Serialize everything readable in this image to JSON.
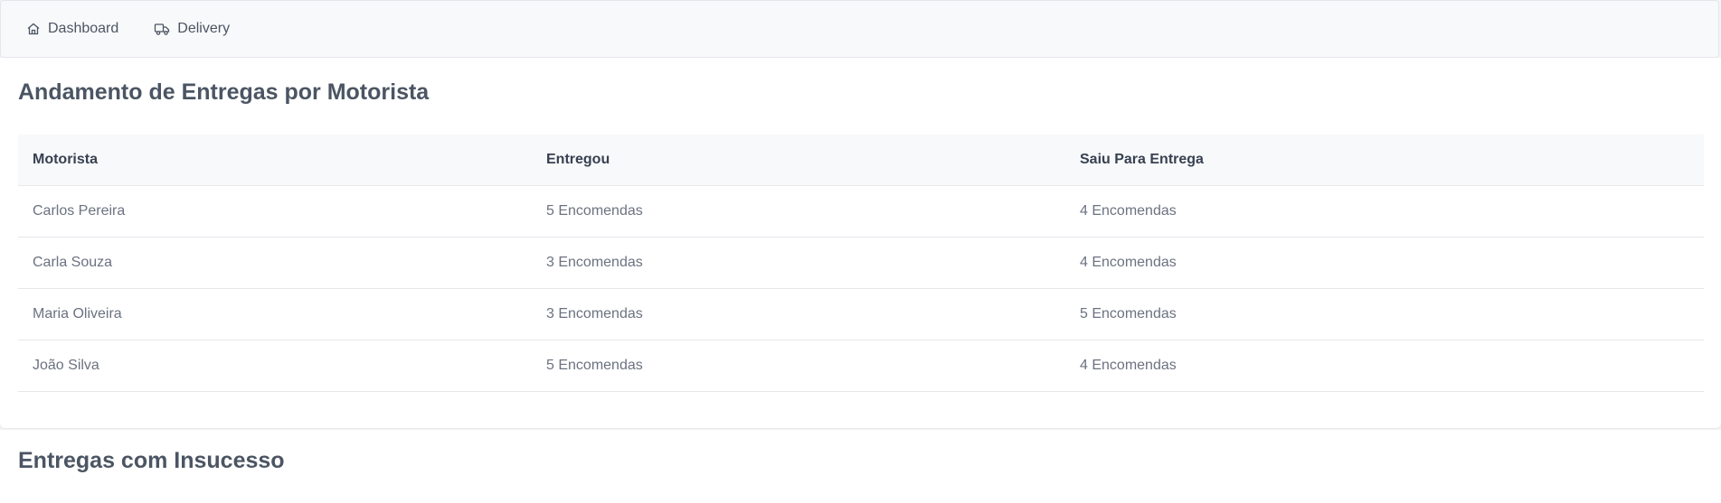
{
  "nav": {
    "items": [
      {
        "label": "Dashboard",
        "icon": "home-icon"
      },
      {
        "label": "Delivery",
        "icon": "truck-icon"
      }
    ]
  },
  "progress_section": {
    "title": "Andamento de Entregas por Motorista",
    "columns": [
      "Motorista",
      "Entregou",
      "Saiu Para Entrega"
    ],
    "rows": [
      [
        "Carlos Pereira",
        "5 Encomendas",
        "4 Encomendas"
      ],
      [
        "Carla Souza",
        "3 Encomendas",
        "4 Encomendas"
      ],
      [
        "Maria Oliveira",
        "3 Encomendas",
        "5 Encomendas"
      ],
      [
        "João Silva",
        "5 Encomendas",
        "4 Encomendas"
      ]
    ]
  },
  "failed_section": {
    "title": "Entregas com Insucesso"
  },
  "colors": {
    "text": "#4b5563",
    "nav_background": "#f8f9fa",
    "page_background": "#f3f4f6",
    "border": "#e5e7eb"
  }
}
